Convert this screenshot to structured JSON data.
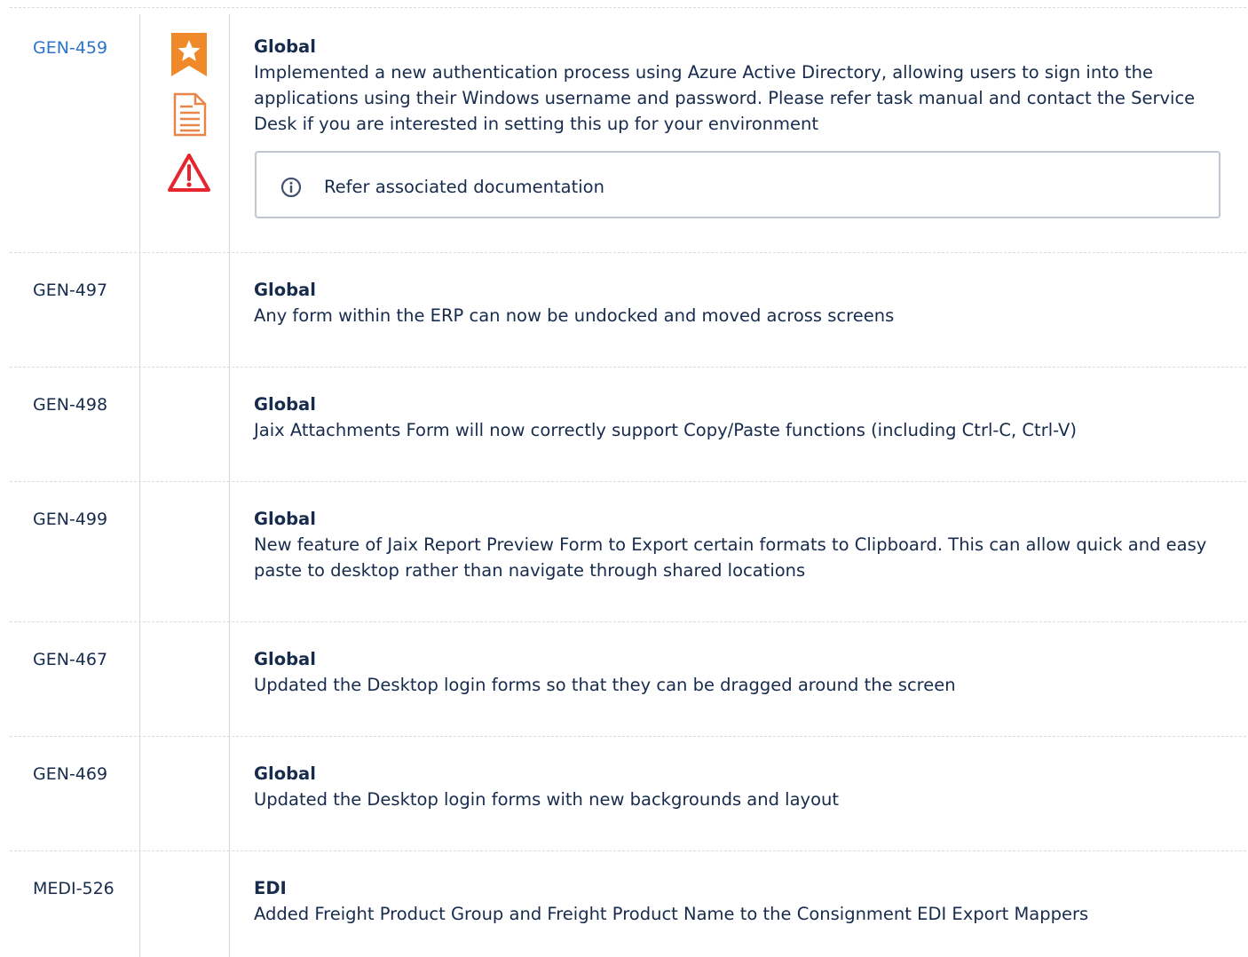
{
  "rows": [
    {
      "key": "GEN-459",
      "category": "Global",
      "description": "Implemented a new authentication process using Azure Active Directory, allowing users to sign into the applications using their Windows username and password.  Please refer task manual and contact the Service Desk if you are interested in setting this up for your environment",
      "note": "Refer associated documentation",
      "icons": [
        "star-bookmark-icon",
        "document-icon",
        "warning-icon"
      ]
    },
    {
      "key": "GEN-497",
      "category": "Global",
      "description": "Any form within the ERP can now be undocked and moved across screens"
    },
    {
      "key": "GEN-498",
      "category": "Global",
      "description": "Jaix Attachments Form will now correctly support Copy/Paste functions (including Ctrl-C, Ctrl-V)"
    },
    {
      "key": "GEN-499",
      "category": "Global",
      "description": "New feature of Jaix Report Preview Form to Export certain formats to Clipboard.  This can allow quick and easy paste to desktop rather than navigate through shared locations"
    },
    {
      "key": "GEN-467",
      "category": "Global",
      "description": "Updated the Desktop login forms so that they can be dragged around the screen"
    },
    {
      "key": "GEN-469",
      "category": "Global",
      "description": "Updated the Desktop login forms with new backgrounds and layout"
    },
    {
      "key": "MEDI-526",
      "category": "EDI",
      "description": "Added Freight Product Group and Freight Product Name to the Consignment EDI Export Mappers"
    }
  ],
  "colors": {
    "link": "#2c74c9",
    "star_badge": "#f0892a",
    "document": "#e8864a",
    "warning": "#e5262e",
    "border": "#c1c7d0"
  }
}
